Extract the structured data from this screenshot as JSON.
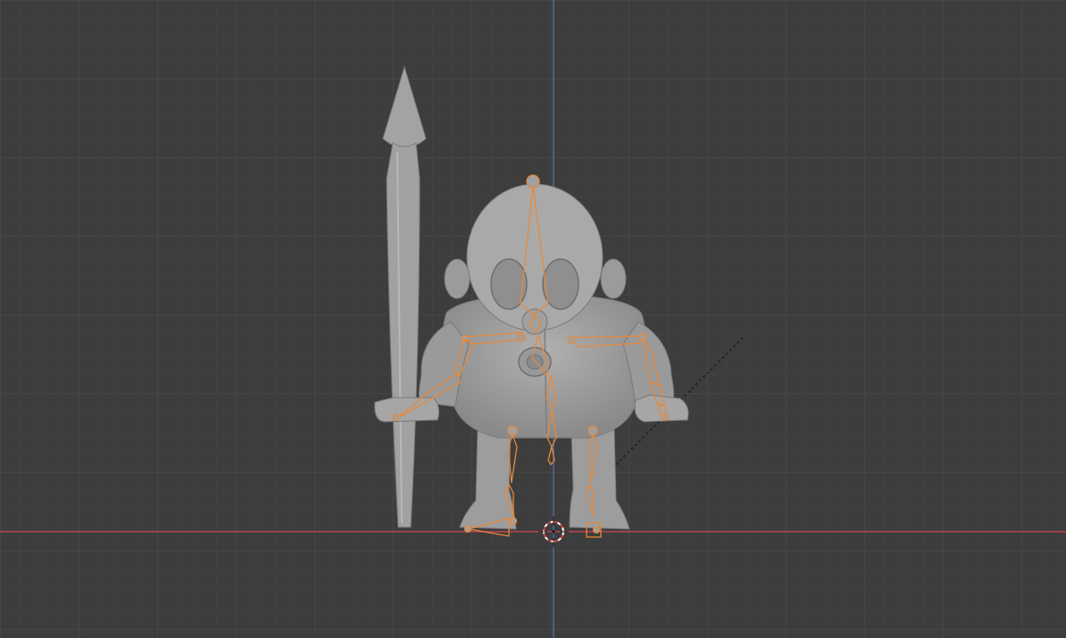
{
  "viewport": {
    "view": "front-orthographic",
    "colors": {
      "background": "#3d3d3d",
      "grid_minor": "#454545",
      "grid_major": "#4e4e4e",
      "axis_x": "#b8444f",
      "axis_z": "#4f78b5",
      "mesh": "#9b9b9b",
      "armature_selected": "#e8893a",
      "cursor_red": "#d23c3c"
    }
  },
  "scene": {
    "objects": [
      {
        "name": "character-mesh",
        "type": "mesh"
      },
      {
        "name": "spear-mesh",
        "type": "mesh"
      },
      {
        "name": "armature",
        "type": "armature",
        "selected": true
      }
    ],
    "bones": [
      "head",
      "neck",
      "spine-upper",
      "spine-lower",
      "spine-base",
      "shoulder-left",
      "upper-arm-left",
      "forearm-left",
      "shoulder-right",
      "upper-arm-right",
      "forearm-right",
      "hand-right",
      "thigh-left",
      "shin-left",
      "foot-left",
      "thigh-right",
      "shin-right",
      "foot-right"
    ]
  }
}
